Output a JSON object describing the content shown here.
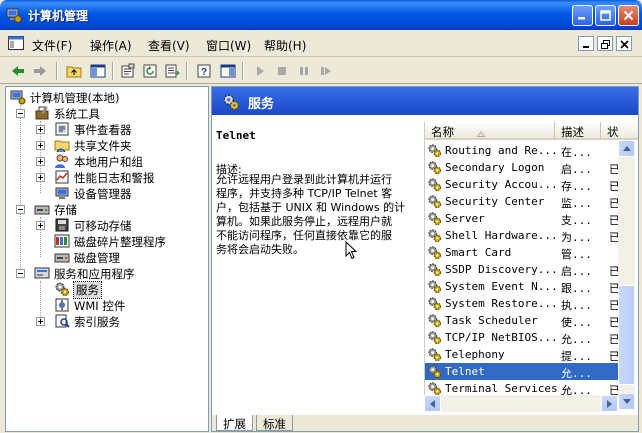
{
  "window": {
    "title": "计算机管理"
  },
  "menu": [
    "文件(F)",
    "操作(A)",
    "查看(V)",
    "窗口(W)",
    "帮助(H)"
  ],
  "tree": {
    "root": "计算机管理(本地)",
    "system_tools": "系统工具",
    "event_viewer": "事件查看器",
    "shared_folders": "共享文件夹",
    "local_users": "本地用户和组",
    "perf_logs": "性能日志和警报",
    "device_manager": "设备管理器",
    "storage": "存储",
    "removable_storage": "可移动存储",
    "defrag": "磁盘碎片整理程序",
    "disk_management": "磁盘管理",
    "services_apps": "服务和应用程序",
    "services": "服务",
    "wmi": "WMI 控件",
    "indexing": "索引服务"
  },
  "panel": {
    "title": "服务",
    "selected_name": "Telnet",
    "desc_label": "描述:",
    "desc_lines": [
      "允许远程用户登录到此计算机并运行",
      "程序，并支持多种 TCP/IP Telnet 客",
      "户，包括基于 UNIX 和 Windows 的计",
      "算机。如果此服务停止，远程用户就",
      "不能访问程序，任何直接依靠它的服",
      "务将会启动失败。"
    ]
  },
  "columns": {
    "name": "名称",
    "desc": "描述",
    "status": "状"
  },
  "services": [
    {
      "name": "Routing and Re...",
      "desc": "在...",
      "status": ""
    },
    {
      "name": "Secondary Logon",
      "desc": "启...",
      "status": "已"
    },
    {
      "name": "Security Accou...",
      "desc": "存...",
      "status": "已"
    },
    {
      "name": "Security Center",
      "desc": "监...",
      "status": "已"
    },
    {
      "name": "Server",
      "desc": "支...",
      "status": "已"
    },
    {
      "name": "Shell Hardware...",
      "desc": "为...",
      "status": "已"
    },
    {
      "name": "Smart Card",
      "desc": "管...",
      "status": ""
    },
    {
      "name": "SSDP Discovery...",
      "desc": "启...",
      "status": "已"
    },
    {
      "name": "System Event N...",
      "desc": "跟...",
      "status": "已"
    },
    {
      "name": "System Restore...",
      "desc": "执...",
      "status": "已"
    },
    {
      "name": "Task Scheduler",
      "desc": "使...",
      "status": "已"
    },
    {
      "name": "TCP/IP NetBIOS...",
      "desc": "允...",
      "status": "已"
    },
    {
      "name": "Telephony",
      "desc": "提...",
      "status": "已"
    },
    {
      "name": "Telnet",
      "desc": "允...",
      "status": ""
    },
    {
      "name": "Terminal Services",
      "desc": "允...",
      "status": "已"
    }
  ],
  "tabs": {
    "extended": "扩展",
    "standard": "标准"
  },
  "colors": {
    "title_blue": "#0058e6",
    "selection": "#316ac5"
  }
}
